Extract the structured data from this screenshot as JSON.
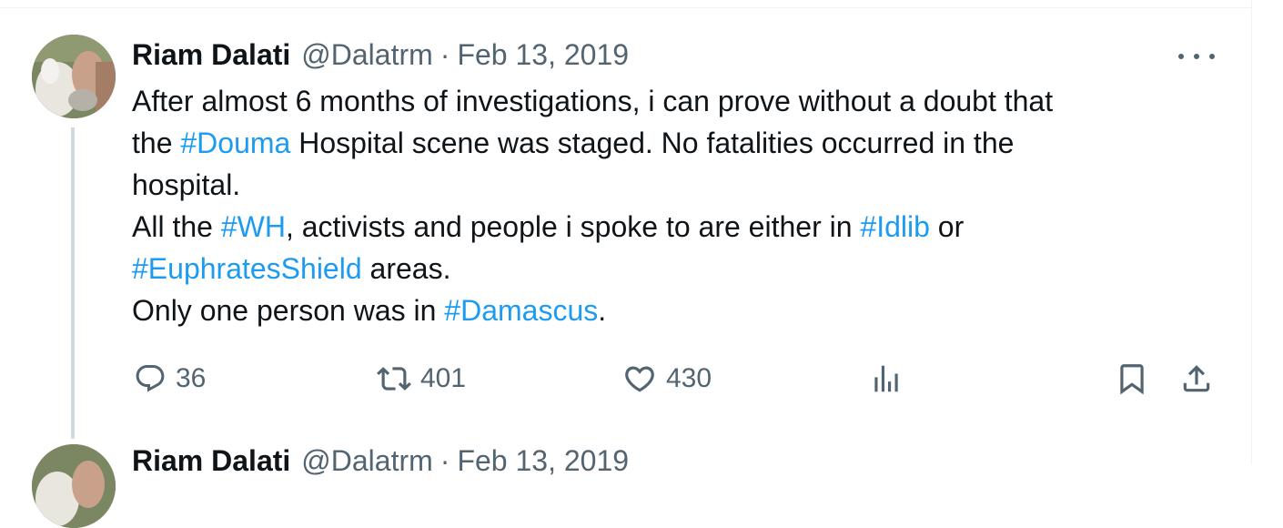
{
  "tweet": {
    "author_name": "Riam Dalati",
    "handle": "@Dalatrm",
    "separator": "·",
    "date": "Feb 13, 2019",
    "lines": [
      [
        {
          "t": "After almost 6 months of investigations, i can prove without a doubt that"
        }
      ],
      [
        {
          "t": "the "
        },
        {
          "t": "#Douma",
          "tag": true
        },
        {
          "t": " Hospital scene was staged. No fatalities occurred in the"
        }
      ],
      [
        {
          "t": "hospital."
        }
      ],
      [
        {
          "t": "All the "
        },
        {
          "t": "#WH",
          "tag": true
        },
        {
          "t": ", activists and people i spoke to are either in "
        },
        {
          "t": "#Idlib",
          "tag": true
        },
        {
          "t": " or"
        }
      ],
      [
        {
          "t": "#EuphratesShield",
          "tag": true
        },
        {
          "t": " areas."
        }
      ],
      [
        {
          "t": "Only one person was in "
        },
        {
          "t": "#Damascus",
          "tag": true
        },
        {
          "t": "."
        }
      ]
    ],
    "stats": {
      "replies": "36",
      "reposts": "401",
      "likes": "430"
    },
    "icons": {
      "reply": "reply-icon",
      "repost": "repost-icon",
      "like": "heart-icon",
      "views": "views-icon",
      "bookmark": "bookmark-icon",
      "share": "share-icon",
      "more": "more-icon"
    },
    "colors": {
      "text": "#0f1419",
      "secondary": "#536471",
      "link": "#1d9bf0",
      "thread_line": "#cfd9de"
    }
  },
  "next_tweet": {
    "author_name": "Riam Dalati",
    "handle": "@Dalatrm",
    "separator": "·",
    "date": "Feb 13, 2019"
  }
}
